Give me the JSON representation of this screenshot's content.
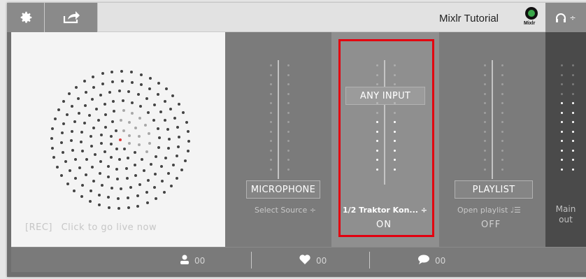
{
  "topbar": {
    "settings_icon": "gear-icon",
    "share_icon": "share-arrow-icon",
    "title": "Mixlr Tutorial",
    "logo_word": "Mixlr",
    "headphones_icon": "headphones-icon",
    "headphones_caret": "÷"
  },
  "live_panel": {
    "rec_label": "[REC]",
    "go_live_label": "Click to go live now",
    "accent_color": "#e03a3a"
  },
  "channels": [
    {
      "button_label": "MICROPHONE",
      "source": "Select Source ÷",
      "state": ""
    },
    {
      "button_label": "ANY INPUT",
      "source": "1/2 Traktor Kon... ÷",
      "state": "ON"
    },
    {
      "button_label": "PLAYLIST",
      "source": "Open playlist ♩☰",
      "state": "OFF"
    }
  ],
  "main_output": {
    "line1": "Main",
    "line2": "out"
  },
  "stats": {
    "listeners": "00",
    "likes": "00",
    "comments": "00"
  },
  "highlight_color": "#e3000f"
}
